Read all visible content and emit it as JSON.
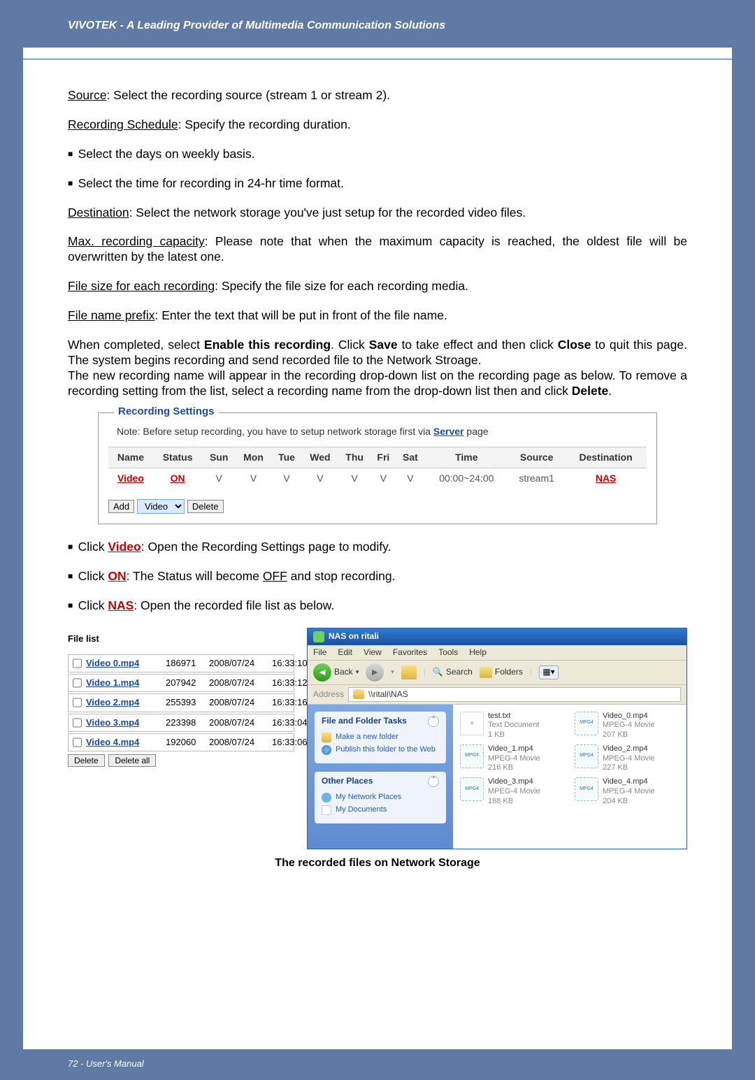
{
  "header": {
    "title": "VIVOTEK - A Leading Provider of Multimedia Communication Solutions"
  },
  "footer": {
    "text": "72 - User's Manual"
  },
  "text": {
    "source_label": "Source",
    "source_desc": ": Select the recording source (stream 1 or stream 2).",
    "sched_label": "Recording Schedule",
    "sched_desc": ": Specify the recording duration.",
    "b1": "Select the days on weekly basis.",
    "b2": "Select the time for recording in 24-hr time format.",
    "dest_label": "Destination",
    "dest_desc": ": Select the network storage you've just setup for the recorded video files.",
    "cap_label": "Max. recording capacity",
    "cap_desc": ": Please note that when the maximum capacity is reached, the oldest file will be overwritten by the latest one.",
    "fs_label": "File size for each recording",
    "fs_desc": ": Specify the file size for each recording media.",
    "fn_label": "File name prefix",
    "fn_desc": ": Enter the text that will be put in front of the file name.",
    "p1a": "When completed, select ",
    "p1b": "Enable this recording",
    "p1c": ". Click ",
    "p1d": "Save",
    "p1e": " to take effect and then click ",
    "p1f": "Close",
    "p1g": " to quit this page. The system begins recording and send recorded file to the Network Stroage.",
    "p2": "The new recording name will appear in the recording drop-down list on the recording page as below. To remove a recording setting from the list, select a recording name from the drop-down list then and click ",
    "p2b": "Delete",
    "p2c": ".",
    "b3a": "Click ",
    "b3b": "Video",
    "b3c": ": Open the Recording Settings page to modify.",
    "b4a": "Click ",
    "b4b": "ON",
    "b4c": ": The Status will become ",
    "b4d": "OFF",
    "b4e": " and stop recording.",
    "b5a": "Click ",
    "b5b": "NAS",
    "b5c": ": Open the recorded file list as below."
  },
  "rs": {
    "legend": "Recording Settings",
    "note_pre": "Note: Before setup recording, you have to setup network storage first via ",
    "note_link": "Server",
    "note_post": " page",
    "cols": [
      "Name",
      "Status",
      "Sun",
      "Mon",
      "Tue",
      "Wed",
      "Thu",
      "Fri",
      "Sat",
      "Time",
      "Source",
      "Destination"
    ],
    "row": {
      "name": "Video",
      "status": "ON",
      "days": [
        "V",
        "V",
        "V",
        "V",
        "V",
        "V",
        "V"
      ],
      "time": "00:00~24:00",
      "source": "stream1",
      "dest": "NAS"
    },
    "btn_add": "Add",
    "dd_val": "Video",
    "btn_del": "Delete"
  },
  "filelist": {
    "title": "File list",
    "rows": [
      {
        "name": "Video 0.mp4",
        "size": "186971",
        "date": "2008/07/24",
        "time": "16:33:10"
      },
      {
        "name": "Video 1.mp4",
        "size": "207942",
        "date": "2008/07/24",
        "time": "16:33:12"
      },
      {
        "name": "Video 2.mp4",
        "size": "255393",
        "date": "2008/07/24",
        "time": "16:33:16"
      },
      {
        "name": "Video 3.mp4",
        "size": "223398",
        "date": "2008/07/24",
        "time": "16:33:04"
      },
      {
        "name": "Video 4.mp4",
        "size": "192060",
        "date": "2008/07/24",
        "time": "16:33:06"
      }
    ],
    "btn_del": "Delete",
    "btn_del_all": "Delete all"
  },
  "explorer": {
    "title": "NAS on ritali",
    "menu": [
      "File",
      "Edit",
      "View",
      "Favorites",
      "Tools",
      "Help"
    ],
    "back": "Back",
    "search": "Search",
    "folders": "Folders",
    "addr_label": "Address",
    "addr_val": "\\\\ritali\\NAS",
    "box1": {
      "title": "File and Folder Tasks",
      "links": [
        "Make a new folder",
        "Publish this folder to the Web"
      ]
    },
    "box2": {
      "title": "Other Places",
      "links": [
        "My Network Places",
        "My Documents"
      ]
    },
    "files": [
      {
        "name": "test.txt",
        "type": "Text Document",
        "size": "1 KB",
        "kind": "txt"
      },
      {
        "name": "Video_0.mp4",
        "type": "MPEG-4 Movie",
        "size": "207 KB",
        "kind": "mpg"
      },
      {
        "name": "Video_1.mp4",
        "type": "MPEG-4 Movie",
        "size": "216 KB",
        "kind": "mpg"
      },
      {
        "name": "Video_2.mp4",
        "type": "MPEG-4 Movie",
        "size": "227 KB",
        "kind": "mpg"
      },
      {
        "name": "Video_3.mp4",
        "type": "MPEG-4 Movie",
        "size": "188 KB",
        "kind": "mpg"
      },
      {
        "name": "Video_4.mp4",
        "type": "MPEG-4 Movie",
        "size": "204 KB",
        "kind": "mpg"
      }
    ]
  },
  "caption": "The recorded files on Network Storage"
}
